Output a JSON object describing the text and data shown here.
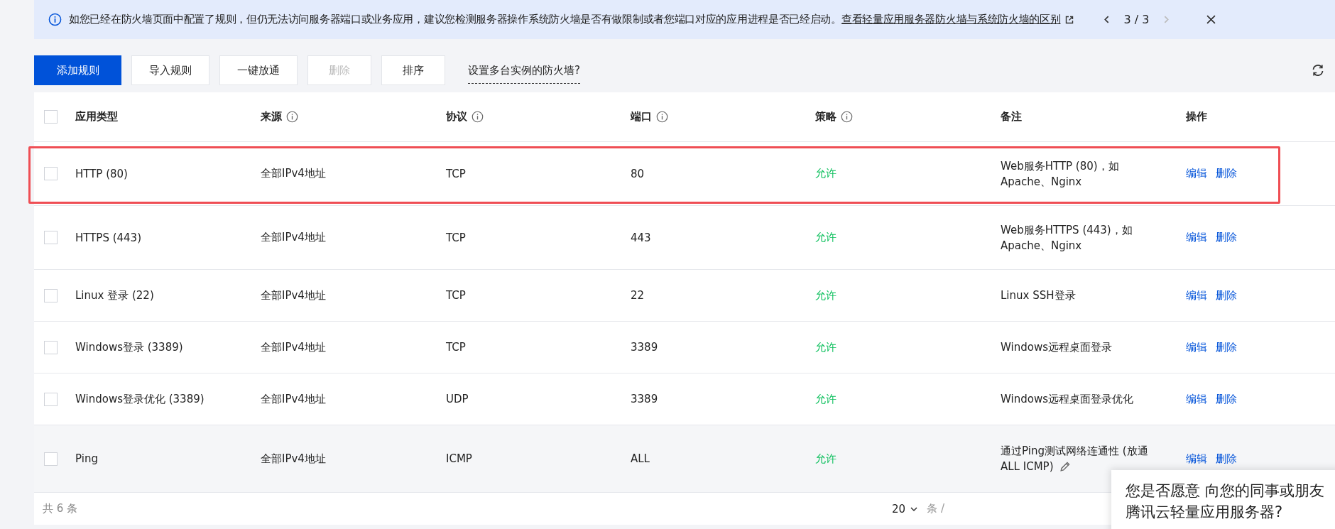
{
  "banner": {
    "text": "如您已经在防火墙页面中配置了规则，但仍无法访问服务器端口或业务应用，建议您检测服务器操作系统防火墙是否有做限制或者您端口对应的应用进程是否已经启动。",
    "link": "查看轻量应用服务器防火墙与系统防火墙的区别",
    "page": "3 / 3",
    "prev_disabled": false,
    "next_disabled": true
  },
  "toolbar": {
    "buttons": [
      {
        "label": "添加规则",
        "kind": "primary",
        "disabled": false
      },
      {
        "label": "导入规则",
        "kind": "default",
        "disabled": false
      },
      {
        "label": "一键放通",
        "kind": "default",
        "disabled": false
      },
      {
        "label": "删除",
        "kind": "default",
        "disabled": true
      },
      {
        "label": "排序",
        "kind": "default",
        "disabled": false
      }
    ],
    "link": "设置多台实例的防火墙?"
  },
  "table": {
    "columns": [
      {
        "label": "应用类型",
        "info": false
      },
      {
        "label": "来源",
        "info": true
      },
      {
        "label": "协议",
        "info": true
      },
      {
        "label": "端口",
        "info": true
      },
      {
        "label": "策略",
        "info": true
      },
      {
        "label": "备注",
        "info": false
      },
      {
        "label": "操作",
        "info": false
      }
    ],
    "header_checked": false,
    "rows": [
      {
        "type": "HTTP (80)",
        "source": "全部IPv4地址",
        "protocol": "TCP",
        "port": "80",
        "policy": "允许",
        "note": "Web服务HTTP (80)，如 Apache、Nginx",
        "actions": [
          "编辑",
          "删除"
        ],
        "checked": false,
        "highlighted": true,
        "hovered": false
      },
      {
        "type": "HTTPS (443)",
        "source": "全部IPv4地址",
        "protocol": "TCP",
        "port": "443",
        "policy": "允许",
        "note": "Web服务HTTPS (443)，如 Apache、Nginx",
        "actions": [
          "编辑",
          "删除"
        ],
        "checked": false,
        "highlighted": false,
        "hovered": false
      },
      {
        "type": "Linux 登录 (22)",
        "source": "全部IPv4地址",
        "protocol": "TCP",
        "port": "22",
        "policy": "允许",
        "note": "Linux SSH登录",
        "actions": [
          "编辑",
          "删除"
        ],
        "checked": false,
        "highlighted": false,
        "hovered": false
      },
      {
        "type": "Windows登录 (3389)",
        "source": "全部IPv4地址",
        "protocol": "TCP",
        "port": "3389",
        "policy": "允许",
        "note": "Windows远程桌面登录",
        "actions": [
          "编辑",
          "删除"
        ],
        "checked": false,
        "highlighted": false,
        "hovered": false
      },
      {
        "type": "Windows登录优化 (3389)",
        "source": "全部IPv4地址",
        "protocol": "UDP",
        "port": "3389",
        "policy": "允许",
        "note": "Windows远程桌面登录优化",
        "actions": [
          "编辑",
          "删除"
        ],
        "checked": false,
        "highlighted": false,
        "hovered": false
      },
      {
        "type": "Ping",
        "source": "全部IPv4地址",
        "protocol": "ICMP",
        "port": "ALL",
        "policy": "允许",
        "note": "通过Ping测试网络连通性 (放通 ALL ICMP)",
        "actions": [
          "编辑",
          "删除"
        ],
        "checked": false,
        "highlighted": false,
        "hovered": true
      }
    ]
  },
  "footer": {
    "total": "共 6 条",
    "page_size": "20",
    "page_size_unit": "条 /"
  },
  "popup": {
    "lines": [
      "您是否愿意 向您的同事或朋友",
      "腾讯云轻量应用服务器?"
    ]
  }
}
